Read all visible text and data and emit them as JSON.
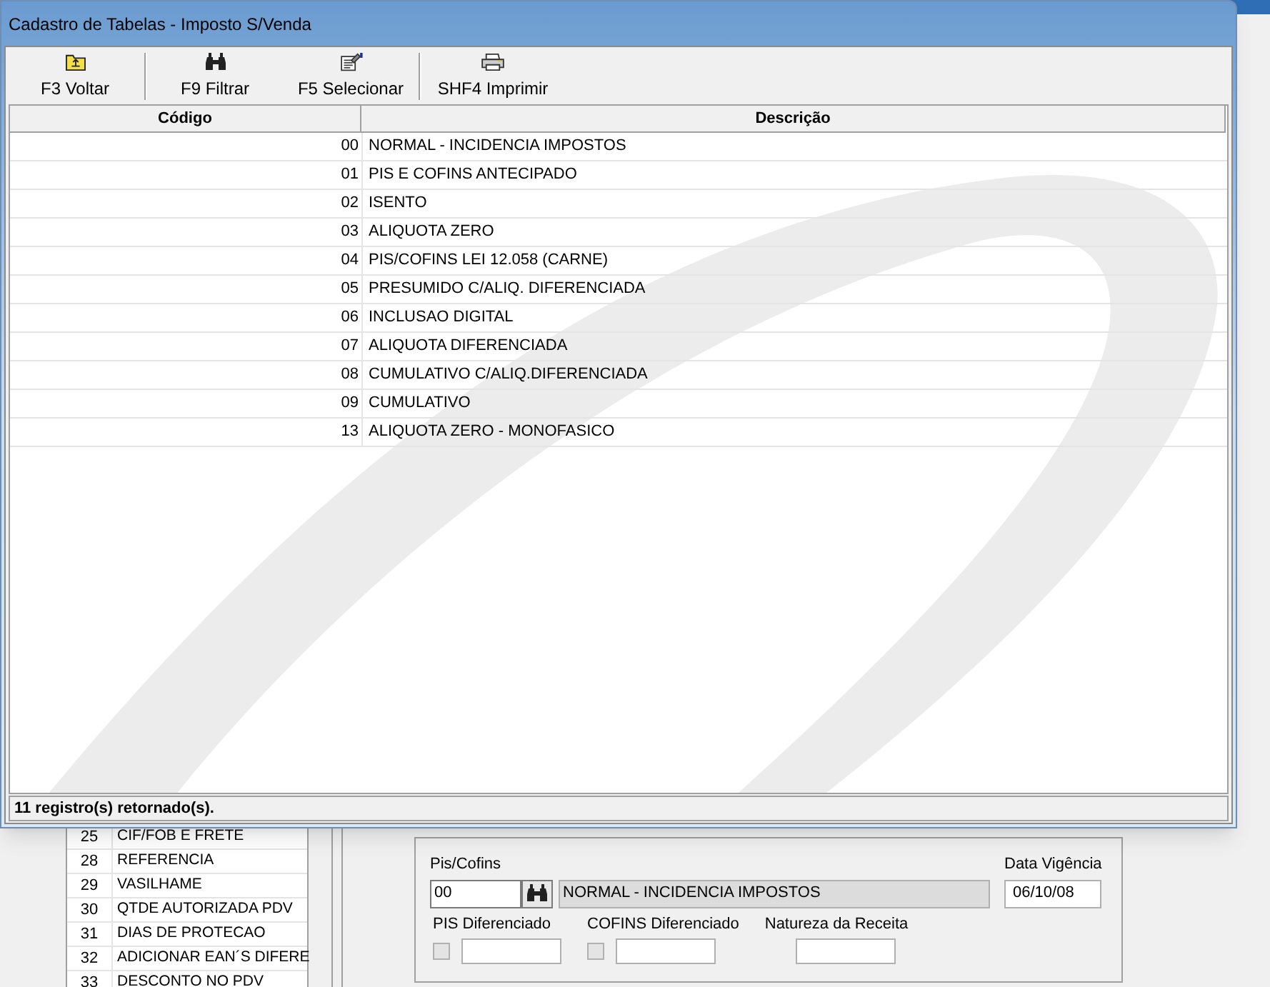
{
  "window": {
    "title": "Cadastro de Tabelas - Imposto S/Venda"
  },
  "toolbar": [
    {
      "label": "F3 Voltar",
      "kind": "back"
    },
    {
      "label": "F9 Filtrar",
      "kind": "filter"
    },
    {
      "label": "F5 Selecionar",
      "kind": "select"
    },
    {
      "label": "SHF4 Imprimir",
      "kind": "print"
    }
  ],
  "table": {
    "columns": [
      "Código",
      "Descrição"
    ],
    "rows": [
      [
        "00",
        "NORMAL - INCIDENCIA IMPOSTOS"
      ],
      [
        "01",
        "PIS E COFINS ANTECIPADO"
      ],
      [
        "02",
        "ISENTO"
      ],
      [
        "03",
        "ALIQUOTA ZERO"
      ],
      [
        "04",
        "PIS/COFINS LEI 12.058 (CARNE)"
      ],
      [
        "05",
        "PRESUMIDO C/ALIQ. DIFERENCIADA"
      ],
      [
        "06",
        "INCLUSAO DIGITAL"
      ],
      [
        "07",
        "ALIQUOTA DIFERENCIADA"
      ],
      [
        "08",
        "CUMULATIVO C/ALIQ.DIFERENCIADA"
      ],
      [
        "09",
        "CUMULATIVO"
      ],
      [
        "13",
        "ALIQUOTA ZERO - MONOFASICO"
      ]
    ]
  },
  "status_bar": "11 registro(s) retornado(s).",
  "background": {
    "list": [
      {
        "code": "25",
        "label": "CIF/FOB E FRETE"
      },
      {
        "code": "28",
        "label": "REFERENCIA"
      },
      {
        "code": "29",
        "label": "VASILHAME"
      },
      {
        "code": "30",
        "label": "QTDE AUTORIZADA PDV"
      },
      {
        "code": "31",
        "label": "DIAS DE PROTECAO"
      },
      {
        "code": "32",
        "label": "ADICIONAR EAN´S DIFERE"
      },
      {
        "code": "33",
        "label": "DESCONTO NO PDV"
      }
    ],
    "form": {
      "pis_cofins": {
        "label": "Pis/Cofins",
        "value": "00",
        "description": "NORMAL - INCIDENCIA IMPOSTOS"
      },
      "data_vigencia": {
        "label": "Data Vigência",
        "value": "06/10/08"
      },
      "pis_diferenciado": {
        "label": "PIS Diferenciado",
        "checked": false
      },
      "cofins_diferenciado": {
        "label": "COFINS Diferenciado",
        "checked": false
      },
      "natureza": {
        "label": "Natureza da Receita"
      }
    }
  }
}
